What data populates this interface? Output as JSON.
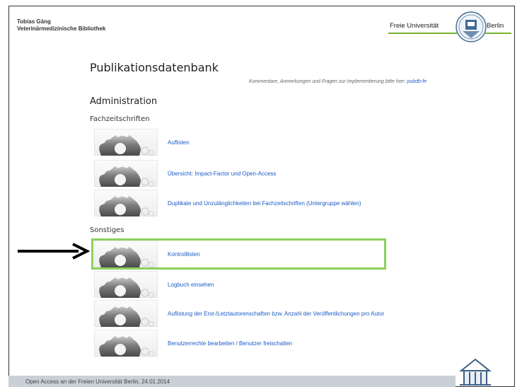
{
  "header": {
    "author_name": "Tobias Gäng",
    "author_affiliation": "Veterinärmedizinische Bibliothek",
    "logo_left_text": "Freie Universität",
    "logo_right_text": "Berlin"
  },
  "app": {
    "title": "Publikationsdatenbank",
    "feedback_text": "Kommentare, Anmerkungen und Fragen zur Implementierung bitte hier: ",
    "feedback_link": "pubdb-fe"
  },
  "admin": {
    "heading": "Administration",
    "groups": [
      {
        "label": "Fachzeitschriften",
        "items": [
          {
            "label": "Auflisten"
          },
          {
            "label": "Übersicht: Impact-Factor und Open-Access"
          },
          {
            "label": "Duplikate und Unzulänglichkeiten bei Fachzeitschriften (Untergruppe wählen)"
          }
        ]
      },
      {
        "label": "Sonstiges",
        "items": [
          {
            "label": "Kontrolllisten",
            "highlighted": true
          },
          {
            "label": "Logbuch einsehen"
          },
          {
            "label": "Auflistung der Erst-/Letztautorenschaften bzw. Anzahl der Veröffentlichungen pro Autor"
          },
          {
            "label": "Benutzerrechte bearbeiten / Benutzer freischalten"
          }
        ]
      }
    ]
  },
  "annotation": {
    "highlight_color": "#8cd05a",
    "arrow_icon": "arrow-right-icon"
  },
  "footer": {
    "text": "Open Access an der Freien Universität Berlin, 24.01.2014"
  },
  "colors": {
    "link": "#1a5bc4",
    "brand_green": "#78b42a",
    "footer_bar": "#c9d0d7"
  }
}
